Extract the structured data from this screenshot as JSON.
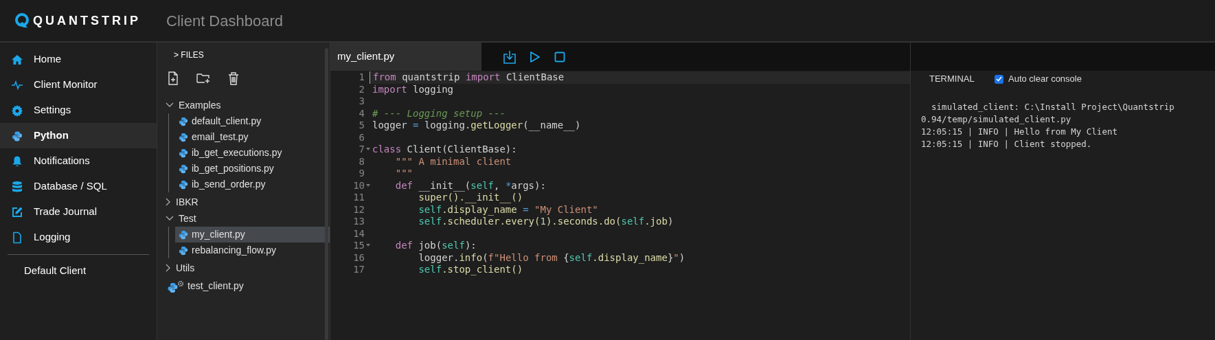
{
  "header": {
    "brand": "QUANTSTRIP",
    "title": "Client Dashboard"
  },
  "sidebar": {
    "items": [
      {
        "label": "Home",
        "selected": false
      },
      {
        "label": "Client Monitor",
        "selected": false
      },
      {
        "label": "Settings",
        "selected": false
      },
      {
        "label": "Python",
        "selected": true
      },
      {
        "label": "Notifications",
        "selected": false
      },
      {
        "label": "Database / SQL",
        "selected": false
      },
      {
        "label": "Trade Journal",
        "selected": false
      },
      {
        "label": "Logging",
        "selected": false
      }
    ],
    "client": "Default Client"
  },
  "files": {
    "title": "> FILES",
    "tree": [
      {
        "kind": "folder",
        "label": "Examples",
        "expanded": true,
        "children": [
          {
            "kind": "script",
            "label": "default_client.py",
            "selected": false
          },
          {
            "kind": "script",
            "label": "email_test.py",
            "selected": false
          },
          {
            "kind": "script",
            "label": "ib_get_executions.py",
            "selected": false
          },
          {
            "kind": "script",
            "label": "ib_get_positions.py",
            "selected": false
          },
          {
            "kind": "script",
            "label": "ib_send_order.py",
            "selected": false
          }
        ]
      },
      {
        "kind": "folder",
        "label": "IBKR",
        "expanded": false
      },
      {
        "kind": "folder",
        "label": "Test",
        "expanded": true,
        "children": [
          {
            "kind": "script",
            "label": "my_client.py",
            "selected": true
          },
          {
            "kind": "script",
            "label": "rebalancing_flow.py",
            "selected": false
          }
        ]
      },
      {
        "kind": "folder",
        "label": "Utils",
        "expanded": false
      },
      {
        "kind": "runner",
        "label": "test_client.py",
        "selected": false
      }
    ]
  },
  "editor": {
    "tab": "my_client.py",
    "lines": [
      {
        "number": "1",
        "current": true,
        "foldable": false,
        "tokens": [
          {
            "kind": "keyword",
            "text": "from"
          },
          {
            "kind": "plain",
            "text": " quantstrip "
          },
          {
            "kind": "keyword",
            "text": "import"
          },
          {
            "kind": "plain",
            "text": " ClientBase"
          }
        ]
      },
      {
        "number": "2",
        "current": false,
        "foldable": false,
        "tokens": [
          {
            "kind": "keyword",
            "text": "import"
          },
          {
            "kind": "plain",
            "text": " logging"
          }
        ]
      },
      {
        "number": "3",
        "current": false,
        "foldable": false
      },
      {
        "number": "4",
        "current": false,
        "foldable": false,
        "tokens": [
          {
            "kind": "comment",
            "text": "# --- Logging setup ---"
          }
        ]
      },
      {
        "number": "5",
        "current": false,
        "foldable": false,
        "tokens": [
          {
            "kind": "plain",
            "text": "logger "
          },
          {
            "kind": "operator",
            "text": "="
          },
          {
            "kind": "plain",
            "text": " logging."
          },
          {
            "kind": "function",
            "text": "getLogger"
          },
          {
            "kind": "plain",
            "text": "(__name__)"
          }
        ]
      },
      {
        "number": "6",
        "current": false,
        "foldable": false
      },
      {
        "number": "7",
        "current": false,
        "foldable": true,
        "tokens": [
          {
            "kind": "keyword",
            "text": "class"
          },
          {
            "kind": "plain",
            "text": " Client(ClientBase):"
          }
        ]
      },
      {
        "number": "8",
        "current": false,
        "foldable": false,
        "tokens": [
          {
            "kind": "string",
            "text": "    \"\"\" A minimal client"
          }
        ]
      },
      {
        "number": "9",
        "current": false,
        "foldable": false,
        "tokens": [
          {
            "kind": "string",
            "text": "    \"\"\""
          }
        ]
      },
      {
        "number": "10",
        "current": false,
        "foldable": true,
        "tokens": [
          {
            "kind": "keyword",
            "text": "    def"
          },
          {
            "kind": "plain",
            "text": " __init__("
          },
          {
            "kind": "self",
            "text": "self"
          },
          {
            "kind": "plain",
            "text": ", "
          },
          {
            "kind": "operator",
            "text": "*"
          },
          {
            "kind": "plain",
            "text": "args):"
          }
        ]
      },
      {
        "number": "11",
        "current": false,
        "foldable": false,
        "tokens": [
          {
            "kind": "function",
            "text": "        super().__init__()"
          }
        ]
      },
      {
        "number": "12",
        "current": false,
        "foldable": false,
        "tokens": [
          {
            "kind": "self",
            "text": "        self"
          },
          {
            "kind": "function",
            "text": ".display_name "
          },
          {
            "kind": "operator",
            "text": "="
          },
          {
            "kind": "string",
            "text": " \"My Client\""
          }
        ]
      },
      {
        "number": "13",
        "current": false,
        "foldable": false,
        "tokens": [
          {
            "kind": "self",
            "text": "        self"
          },
          {
            "kind": "function",
            "text": ".scheduler.every("
          },
          {
            "kind": "number",
            "text": "1"
          },
          {
            "kind": "function",
            "text": ").seconds.do("
          },
          {
            "kind": "self",
            "text": "self"
          },
          {
            "kind": "function",
            "text": ".job"
          },
          {
            "kind": "plain",
            "text": ")"
          }
        ]
      },
      {
        "number": "14",
        "current": false,
        "foldable": false
      },
      {
        "number": "15",
        "current": false,
        "foldable": true,
        "tokens": [
          {
            "kind": "keyword",
            "text": "    def"
          },
          {
            "kind": "plain",
            "text": " job("
          },
          {
            "kind": "self",
            "text": "self"
          },
          {
            "kind": "plain",
            "text": "):"
          }
        ]
      },
      {
        "number": "16",
        "current": false,
        "foldable": false,
        "tokens": [
          {
            "kind": "plain",
            "text": "        logger."
          },
          {
            "kind": "function",
            "text": "info"
          },
          {
            "kind": "plain",
            "text": "("
          },
          {
            "kind": "string",
            "text": "f\"Hello from "
          },
          {
            "kind": "plain",
            "text": "{"
          },
          {
            "kind": "self",
            "text": "self"
          },
          {
            "kind": "function",
            "text": ".display_name"
          },
          {
            "kind": "plain",
            "text": "}"
          },
          {
            "kind": "string",
            "text": "\""
          },
          {
            "kind": "plain",
            "text": ")"
          }
        ]
      },
      {
        "number": "17",
        "current": false,
        "foldable": false,
        "tokens": [
          {
            "kind": "self",
            "text": "        self"
          },
          {
            "kind": "function",
            "text": ".stop_client()"
          }
        ]
      }
    ]
  },
  "terminal": {
    "title": "TERMINAL",
    "auto_clear": {
      "label": "Auto clear console",
      "checked": true
    },
    "output": "  simulated_client: C:\\Install Project\\Quantstrip\n0.94/temp/simulated_client.py\n12:05:15 | INFO | Hello from My Client\n12:05:15 | INFO | Client stopped."
  }
}
